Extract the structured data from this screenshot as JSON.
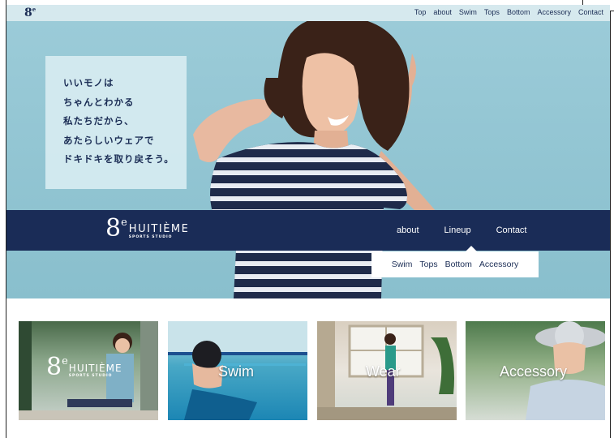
{
  "topbar": {
    "logo": "8",
    "logo_sup": "e",
    "nav": [
      "Top",
      "about",
      "Swim",
      "Tops",
      "Bottom",
      "Accessory",
      "Contact"
    ]
  },
  "hero": {
    "catch_lines": [
      "いいモノは",
      "ちゃんとわかる",
      "私たちだから、",
      "あたらしいウェアで",
      "ドキドキを取り戻そう。"
    ]
  },
  "brand": {
    "numeral": "8",
    "sup": "e",
    "name": "HUITIÈME",
    "sub": "SPORTS STUDIO"
  },
  "band_nav": {
    "about": "about",
    "lineup": "Lineup",
    "contact": "Contact"
  },
  "dropdown": [
    "Swim",
    "Tops",
    "Bottom",
    "Accessory"
  ],
  "thumbnails": {
    "brand_numeral": "8",
    "brand_sup": "e",
    "brand_name": "HUITIÈME",
    "brand_sub": "SPORTS STUDIO",
    "swim": "Swim",
    "wear": "Wear",
    "accessory": "Accessory"
  },
  "colors": {
    "navy": "#1a2c57",
    "hero_blue": "#8fc3d1",
    "topbar": "#d6e9ee"
  }
}
